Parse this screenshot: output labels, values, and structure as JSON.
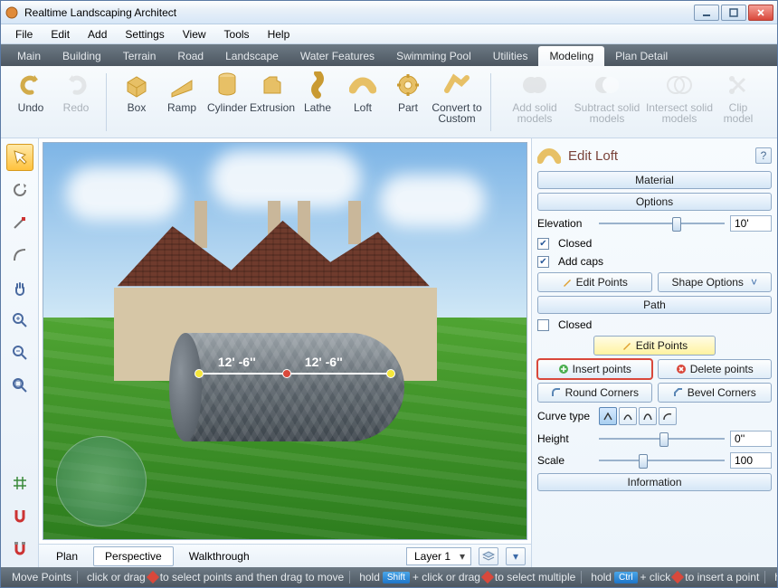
{
  "title": "Realtime Landscaping Architect",
  "menu": [
    "File",
    "Edit",
    "Add",
    "Settings",
    "View",
    "Tools",
    "Help"
  ],
  "tabs": [
    "Main",
    "Building",
    "Terrain",
    "Road",
    "Landscape",
    "Water Features",
    "Swimming Pool",
    "Utilities",
    "Modeling",
    "Plan Detail"
  ],
  "active_tab": "Modeling",
  "ribbon": {
    "undo": "Undo",
    "redo": "Redo",
    "box": "Box",
    "ramp": "Ramp",
    "cylinder": "Cylinder",
    "extrusion": "Extrusion",
    "lathe": "Lathe",
    "loft": "Loft",
    "part": "Part",
    "convert": "Convert to Custom",
    "addsolid": "Add solid models",
    "subtract": "Subtract solid models",
    "intersect": "Intersect solid models",
    "clip": "Clip model"
  },
  "viewtabs": [
    "Plan",
    "Perspective",
    "Walkthrough"
  ],
  "active_view": "Perspective",
  "layer": "Layer 1",
  "dims": {
    "a": "12' -6''",
    "b": "12' -6''"
  },
  "panel": {
    "title": "Edit Loft",
    "material": "Material",
    "options": "Options",
    "elevation_label": "Elevation",
    "elevation_value": "10'",
    "closed": "Closed",
    "addcaps": "Add caps",
    "edit_points": "Edit Points",
    "shape_options": "Shape Options",
    "path": "Path",
    "path_closed": "Closed",
    "insert_points": "Insert points",
    "delete_points": "Delete points",
    "round_corners": "Round Corners",
    "bevel_corners": "Bevel Corners",
    "curve_type": "Curve type",
    "height_label": "Height",
    "height_value": "0''",
    "scale_label": "Scale",
    "scale_value": "100",
    "information": "Information"
  },
  "status": {
    "mode": "Move Points",
    "s1": "click or drag",
    "s2": "to select points and then drag to move",
    "hold": "hold",
    "shift": "Shift",
    "ctrl": "Ctrl",
    "s3": "+ click or drag",
    "s4": "to select multiple",
    "s5": "+ click",
    "s6": "to insert a point"
  }
}
